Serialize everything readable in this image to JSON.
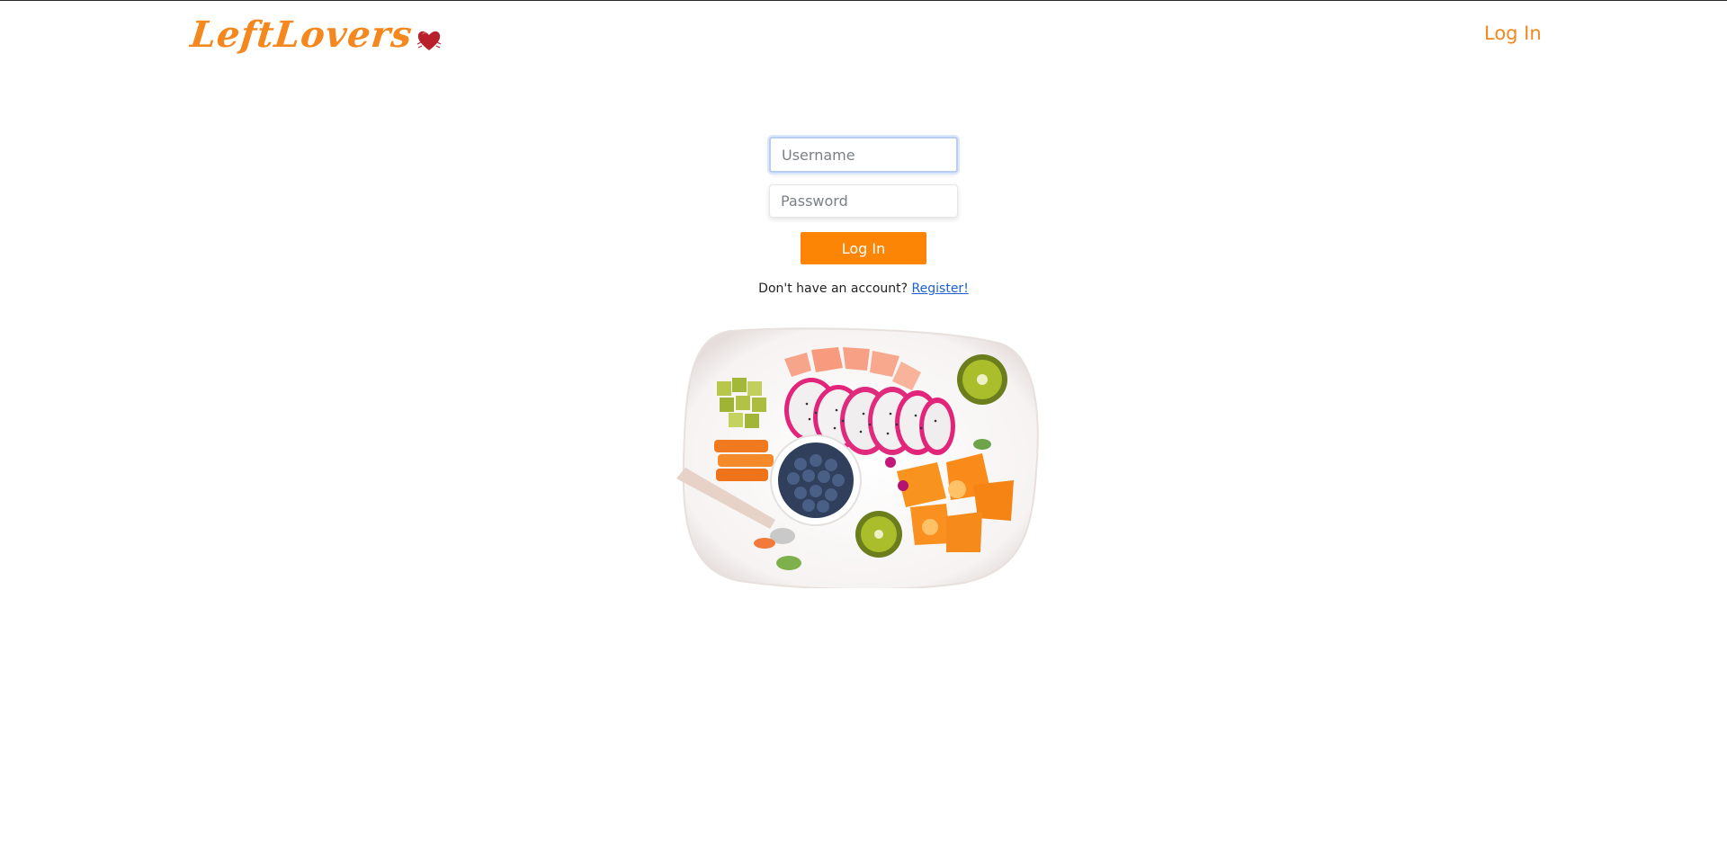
{
  "brand": {
    "name": "LeftLovers",
    "accent_color": "#f5871f",
    "heart_icon": "heart-icon"
  },
  "nav": {
    "login_label": "Log In"
  },
  "form": {
    "username_placeholder": "Username",
    "password_placeholder": "Password",
    "login_button_label": "Log In",
    "button_color": "#fd8505"
  },
  "register": {
    "prompt": "Don't have an account?",
    "link_label": "Register!"
  },
  "hero_image": {
    "icon": "fruit-platter-image"
  }
}
